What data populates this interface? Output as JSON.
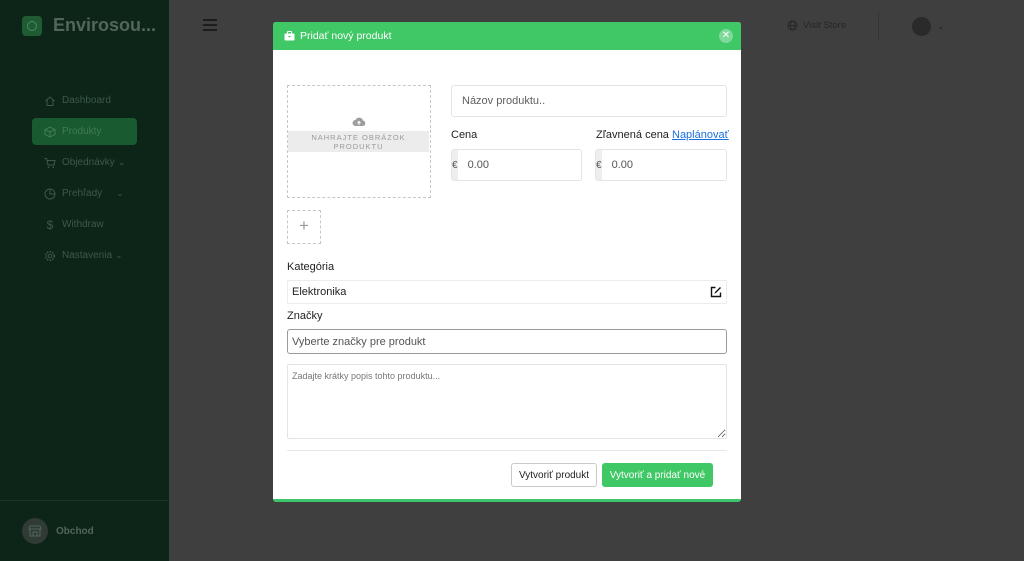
{
  "sidebar": {
    "brand": "Envirosou...",
    "items": [
      {
        "label": "Dashboard",
        "icon": "home-icon"
      },
      {
        "label": "Produkty",
        "icon": "box-icon",
        "active": true
      },
      {
        "label": "Objednávky",
        "icon": "cart-icon",
        "chevron": "⌄"
      },
      {
        "label": "Prehľady",
        "icon": "pie-chart-icon",
        "chevron": "⌄"
      },
      {
        "label": "Withdraw",
        "icon": "dollar-icon"
      },
      {
        "label": "Nastavenia",
        "icon": "gear-icon",
        "chevron": "⌄"
      }
    ],
    "footer_label": "Obchod"
  },
  "topbar": {
    "visit_store": "Visit Store",
    "user_chevron": "⌄"
  },
  "modal": {
    "title": "Pridať nový produkt",
    "close": "✕",
    "upload_text": "NAHRAJTE OBRÁZOK PRODUKTU",
    "add_image": "+",
    "name_placeholder": "Názov produktu..",
    "price_label": "Cena",
    "discount_label": "Zľavnená cena",
    "schedule_link": "Naplánovať",
    "currency": "€",
    "price_placeholder": "0.00",
    "discount_placeholder": "0.00",
    "category_label": "Kategória",
    "category_value": "Elektronika",
    "tags_label": "Značky",
    "tags_placeholder": "Vyberte značky pre produkt",
    "description_placeholder": "Zadajte krátky popis tohto produktu...",
    "create_button": "Vytvoriť produkt",
    "create_add_button": "Vytvoriť a pridať nové"
  },
  "colors": {
    "accent": "#40c766",
    "overlay": "#3f3f3f",
    "sidebar": "#0d2418",
    "link": "#1a6fe0"
  }
}
